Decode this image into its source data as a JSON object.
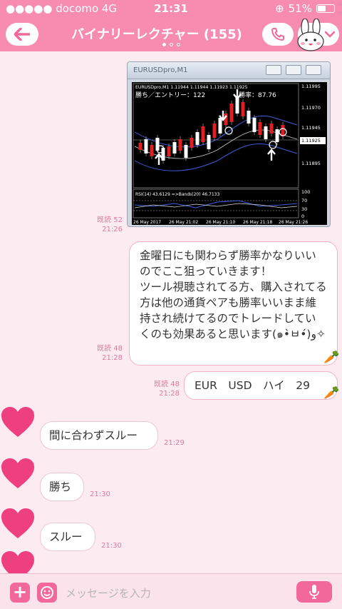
{
  "status": {
    "carrier": "●●●●● docomo  4G",
    "time": "21:31",
    "battery": "51%",
    "battery_level": 0.51
  },
  "header": {
    "title": "バイナリーレクチャー (155)",
    "page_dots": 3,
    "active_dot": 0
  },
  "chart_image": {
    "window_title": "EURUSDpro,M1",
    "symbol_line": "EURUSDpro,M1  1.11944 1.11944 1.11923 1.11925",
    "win_text": "勝ち／エントリー：122",
    "win_rate_text": "勝率：87.76",
    "price_labels": [
      "1.11995",
      "1.11970",
      "1.11945",
      "1.11925",
      "1.11895"
    ],
    "indicator_label": "RSI(14) 43.6129  =>Bands(20) 46.7133",
    "indicator_levels": [
      "100",
      "70",
      "30",
      "0"
    ],
    "time_labels": [
      "26 May 2017",
      "26 May 21:02",
      "26 May 21:10",
      "26 May 21:18",
      "26 May 21:26"
    ]
  },
  "messages": [
    {
      "read": "既読 52",
      "time": "21:26"
    },
    {
      "read": "既読 48",
      "time": "21:28",
      "text": "金曜日にも関わらず勝率かなりいいのでここ狙っていきます！\nツール視聴されてる方、購入されてる方は他の通貨ペアも勝率いいまま維持され続けてるのでトレードしていくのも効果あると思います(๑•̀ㅂ•́)و✧"
    },
    {
      "read": "既読 48",
      "time": "21:28",
      "text": "EUR　USD　ハイ　29"
    },
    {
      "time": "21:29",
      "text": "間に合わずスルー"
    },
    {
      "time": "21:30",
      "text": "勝ち"
    },
    {
      "time": "21:30",
      "text": "スルー"
    }
  ],
  "input": {
    "placeholder": "メッセージを入力"
  },
  "colors": {
    "accent": "#f78bb0",
    "button": "#f3689a",
    "heart": "#ee3f80"
  },
  "icons": [
    "back-arrow-icon",
    "phone-icon",
    "bunny-avatar-icon",
    "chevron-down-icon",
    "carrot-icon",
    "heart-avatar-icon",
    "plus-icon",
    "emoji-icon",
    "mic-icon"
  ]
}
